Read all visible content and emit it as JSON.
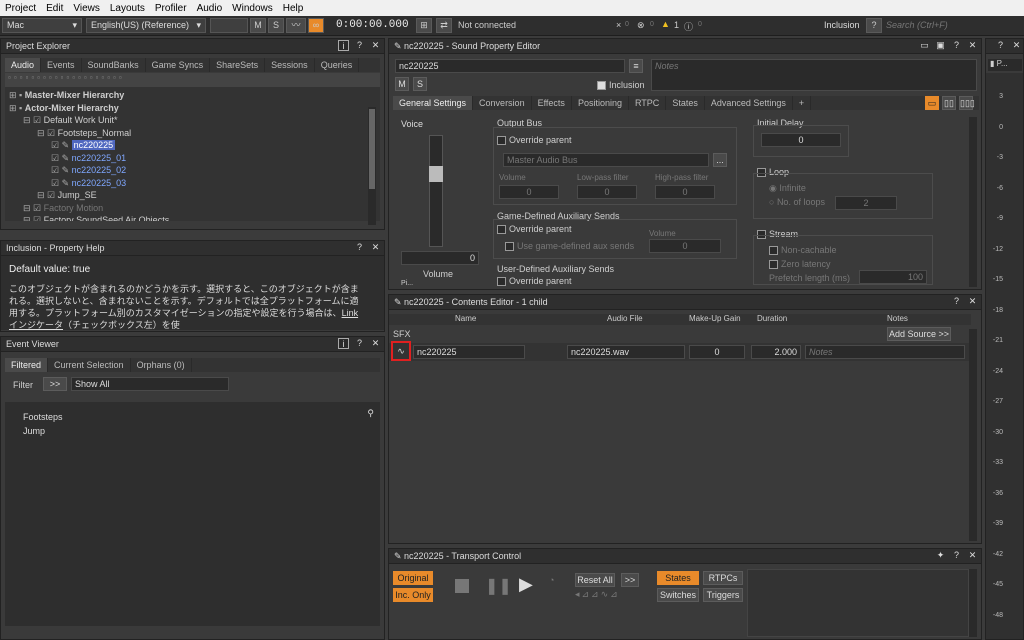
{
  "menu": [
    "Project",
    "Edit",
    "Views",
    "Layouts",
    "Profiler",
    "Audio",
    "Windows",
    "Help"
  ],
  "toolbar": {
    "platform": "Mac",
    "language": "English(US) (Reference)",
    "m": "M",
    "s": "S",
    "time": "0:00:00.000",
    "connection": "Not connected",
    "err_count": "0",
    "warn_count": "1",
    "info_count": "0",
    "warn_pre": "0",
    "inclusion": "Inclusion",
    "help": "?",
    "search_placeholder": "Search (Ctrl+F)"
  },
  "explorer": {
    "title": "Project Explorer",
    "tabs": [
      "Audio",
      "Events",
      "SoundBanks",
      "Game Syncs",
      "ShareSets",
      "Sessions",
      "Queries"
    ],
    "tree": [
      {
        "label": "Master-Mixer Hierarchy",
        "indent": 0,
        "bold": true,
        "cls": ""
      },
      {
        "label": "Actor-Mixer Hierarchy",
        "indent": 0,
        "bold": true,
        "cls": ""
      },
      {
        "label": "Default Work Unit*",
        "indent": 1,
        "bold": false,
        "cls": ""
      },
      {
        "label": "Footsteps_Normal",
        "indent": 2,
        "bold": false,
        "cls": ""
      },
      {
        "label": "nc220225",
        "indent": 3,
        "bold": false,
        "cls": "sel"
      },
      {
        "label": "nc220225_01",
        "indent": 3,
        "bold": false,
        "cls": "blue"
      },
      {
        "label": "nc220225_02",
        "indent": 3,
        "bold": false,
        "cls": "blue"
      },
      {
        "label": "nc220225_03",
        "indent": 3,
        "bold": false,
        "cls": "blue"
      },
      {
        "label": "Jump_SE",
        "indent": 2,
        "bold": false,
        "cls": ""
      },
      {
        "label": "Factory Motion",
        "indent": 1,
        "bold": false,
        "cls": "dim"
      },
      {
        "label": "Factory SoundSeed Air Objects",
        "indent": 1,
        "bold": false,
        "cls": ""
      }
    ]
  },
  "help": {
    "title": "Inclusion - Property Help",
    "default": "Default value: true",
    "text": "このオブジェクトが含まれるのかどうかを示す。選択すると、このオブジェクトが含まれる。選択しないと、含まれないことを示す。デフォルトでは全プラットフォームに適用する。プラットフォーム別のカスタマイゼーションの指定や設定を行う場合は、",
    "link": "Linkインジケータ",
    "text2": "（チェックボックス左）を使"
  },
  "events": {
    "title": "Event Viewer",
    "tabs": [
      "Filtered",
      "Current Selection",
      "Orphans (0)"
    ],
    "filter_label": "Filter",
    "filter_btn": ">>",
    "show": "Show All",
    "items": [
      "Footsteps",
      "Jump"
    ]
  },
  "editor": {
    "title": "nc220225 - Sound Property Editor",
    "name": "nc220225",
    "m": "M",
    "s": "S",
    "inclusion": "Inclusion",
    "notes": "Notes",
    "tabs": [
      "General Settings",
      "Conversion",
      "Effects",
      "Positioning",
      "RTPC",
      "States",
      "Advanced Settings",
      "+"
    ],
    "voice": "Voice",
    "volume_val": "0",
    "volume_label": "Volume",
    "pitch_partial": "Pi...",
    "output_bus": "Output Bus",
    "override_parent": "Override parent",
    "master_bus": "Master Audio Bus",
    "more": "...",
    "vol": "Volume",
    "lpf": "Low-pass filter",
    "hpf": "High-pass filter",
    "v0": "0",
    "v1": "0",
    "v2": "0",
    "game_aux": "Game-Defined Auxiliary Sends",
    "use_aux": "Use game-defined aux sends",
    "aux_vol": "Volume",
    "aux_val": "0",
    "user_aux": "User-Defined Auxiliary Sends",
    "initial_delay": "Initial Delay",
    "delay_val": "0",
    "loop": "Loop",
    "infinite": "Infinite",
    "num_loops": "No. of loops",
    "loops_val": "2",
    "stream": "Stream",
    "non_cachable": "Non-cachable",
    "zero_latency": "Zero latency",
    "prefetch": "Prefetch length (ms)",
    "prefetch_val": "100"
  },
  "contents": {
    "title": "nc220225 - Contents Editor - 1 child",
    "cols": [
      "Name",
      "Audio File",
      "Make-Up Gain",
      "Duration",
      "Notes"
    ],
    "sfx": "SFX",
    "add_source": "Add Source >>",
    "row": {
      "name": "nc220225",
      "file": "nc220225.wav",
      "gain": "0",
      "duration": "2.000",
      "notes": "Notes"
    }
  },
  "transport": {
    "title": "nc220225 - Transport Control",
    "original": "Original",
    "inc_only": "Inc. Only",
    "reset_all": "Reset All",
    "more": ">>",
    "states": "States",
    "rtpcs": "RTPCs",
    "switches": "Switches",
    "triggers": "Triggers"
  },
  "meter": {
    "title": "P...",
    "ticks": [
      "3",
      "0",
      "-3",
      "-6",
      "-9",
      "-12",
      "-15",
      "-18",
      "-21",
      "-24",
      "-27",
      "-30",
      "-33",
      "-36",
      "-39",
      "-42",
      "-45",
      "-48"
    ]
  }
}
